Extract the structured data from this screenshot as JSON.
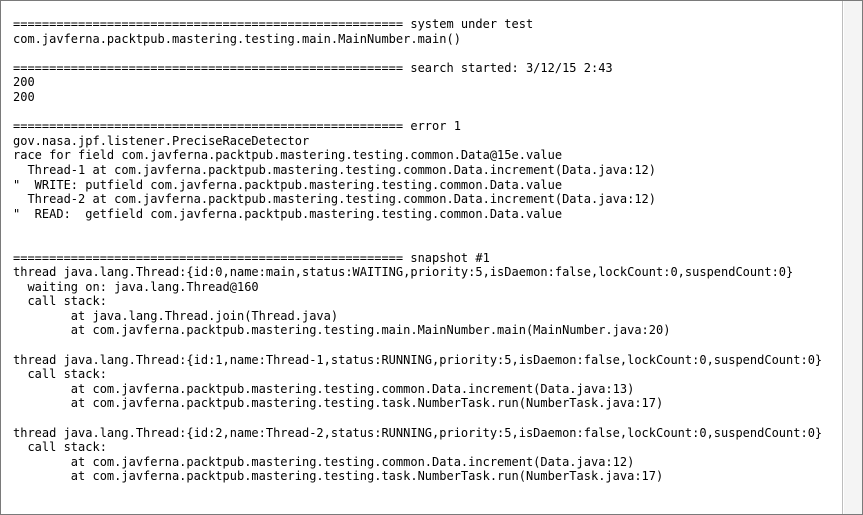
{
  "console": {
    "lines": [
      "====================================================== system under test",
      "com.javferna.packtpub.mastering.testing.main.MainNumber.main()",
      "",
      "====================================================== search started: 3/12/15 2:43",
      "200",
      "200",
      "",
      "====================================================== error 1",
      "gov.nasa.jpf.listener.PreciseRaceDetector",
      "race for field com.javferna.packtpub.mastering.testing.common.Data@15e.value",
      "  Thread-1 at com.javferna.packtpub.mastering.testing.common.Data.increment(Data.java:12)",
      "\"  WRITE: putfield com.javferna.packtpub.mastering.testing.common.Data.value",
      "  Thread-2 at com.javferna.packtpub.mastering.testing.common.Data.increment(Data.java:12)",
      "\"  READ:  getfield com.javferna.packtpub.mastering.testing.common.Data.value",
      "",
      "",
      "====================================================== snapshot #1",
      "thread java.lang.Thread:{id:0,name:main,status:WAITING,priority:5,isDaemon:false,lockCount:0,suspendCount:0}",
      "  waiting on: java.lang.Thread@160",
      "  call stack:",
      "        at java.lang.Thread.join(Thread.java)",
      "        at com.javferna.packtpub.mastering.testing.main.MainNumber.main(MainNumber.java:20)",
      "",
      "thread java.lang.Thread:{id:1,name:Thread-1,status:RUNNING,priority:5,isDaemon:false,lockCount:0,suspendCount:0}",
      "  call stack:",
      "        at com.javferna.packtpub.mastering.testing.common.Data.increment(Data.java:13)",
      "        at com.javferna.packtpub.mastering.testing.task.NumberTask.run(NumberTask.java:17)",
      "",
      "thread java.lang.Thread:{id:2,name:Thread-2,status:RUNNING,priority:5,isDaemon:false,lockCount:0,suspendCount:0}",
      "  call stack:",
      "        at com.javferna.packtpub.mastering.testing.common.Data.increment(Data.java:12)",
      "        at com.javferna.packtpub.mastering.testing.task.NumberTask.run(NumberTask.java:17)"
    ]
  }
}
